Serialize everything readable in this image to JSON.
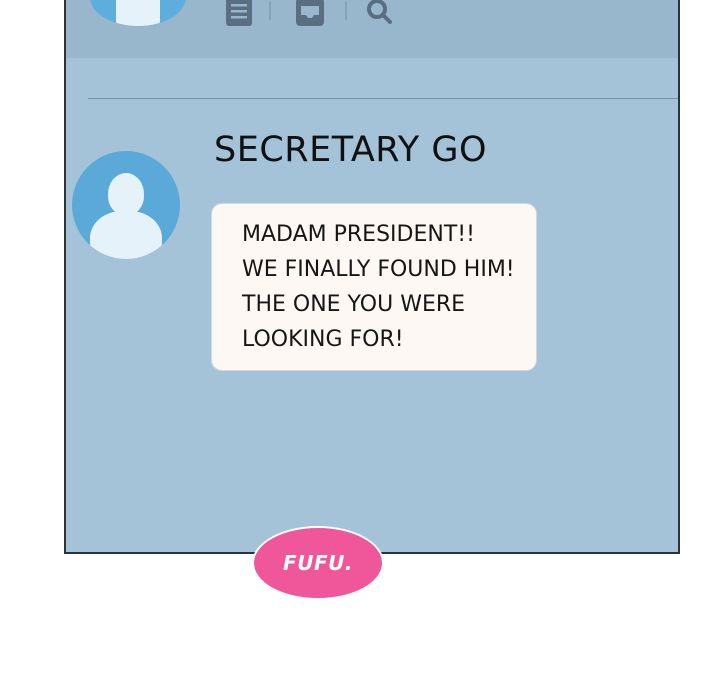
{
  "colors": {
    "screen_bg": "#a5c3d8",
    "topbar_bg": "#98b6cc",
    "avatar_blue": "#5ba9d8",
    "bubble_bg": "#fdf8f3",
    "sticker_pink": "#f0579b",
    "frame_border": "#2e3236"
  },
  "topbar": {
    "icons": [
      "profile-avatar-icon",
      "document-icon",
      "inbox-icon",
      "search-icon"
    ]
  },
  "chat": {
    "contact_name": "SECRETARY GO",
    "message_lines": [
      "MADAM PRESIDENT!!",
      "WE FINALLY FOUND HIM!",
      "THE ONE YOU WERE",
      "LOOKING FOR!"
    ]
  },
  "sticker": {
    "label": "FUFU."
  }
}
